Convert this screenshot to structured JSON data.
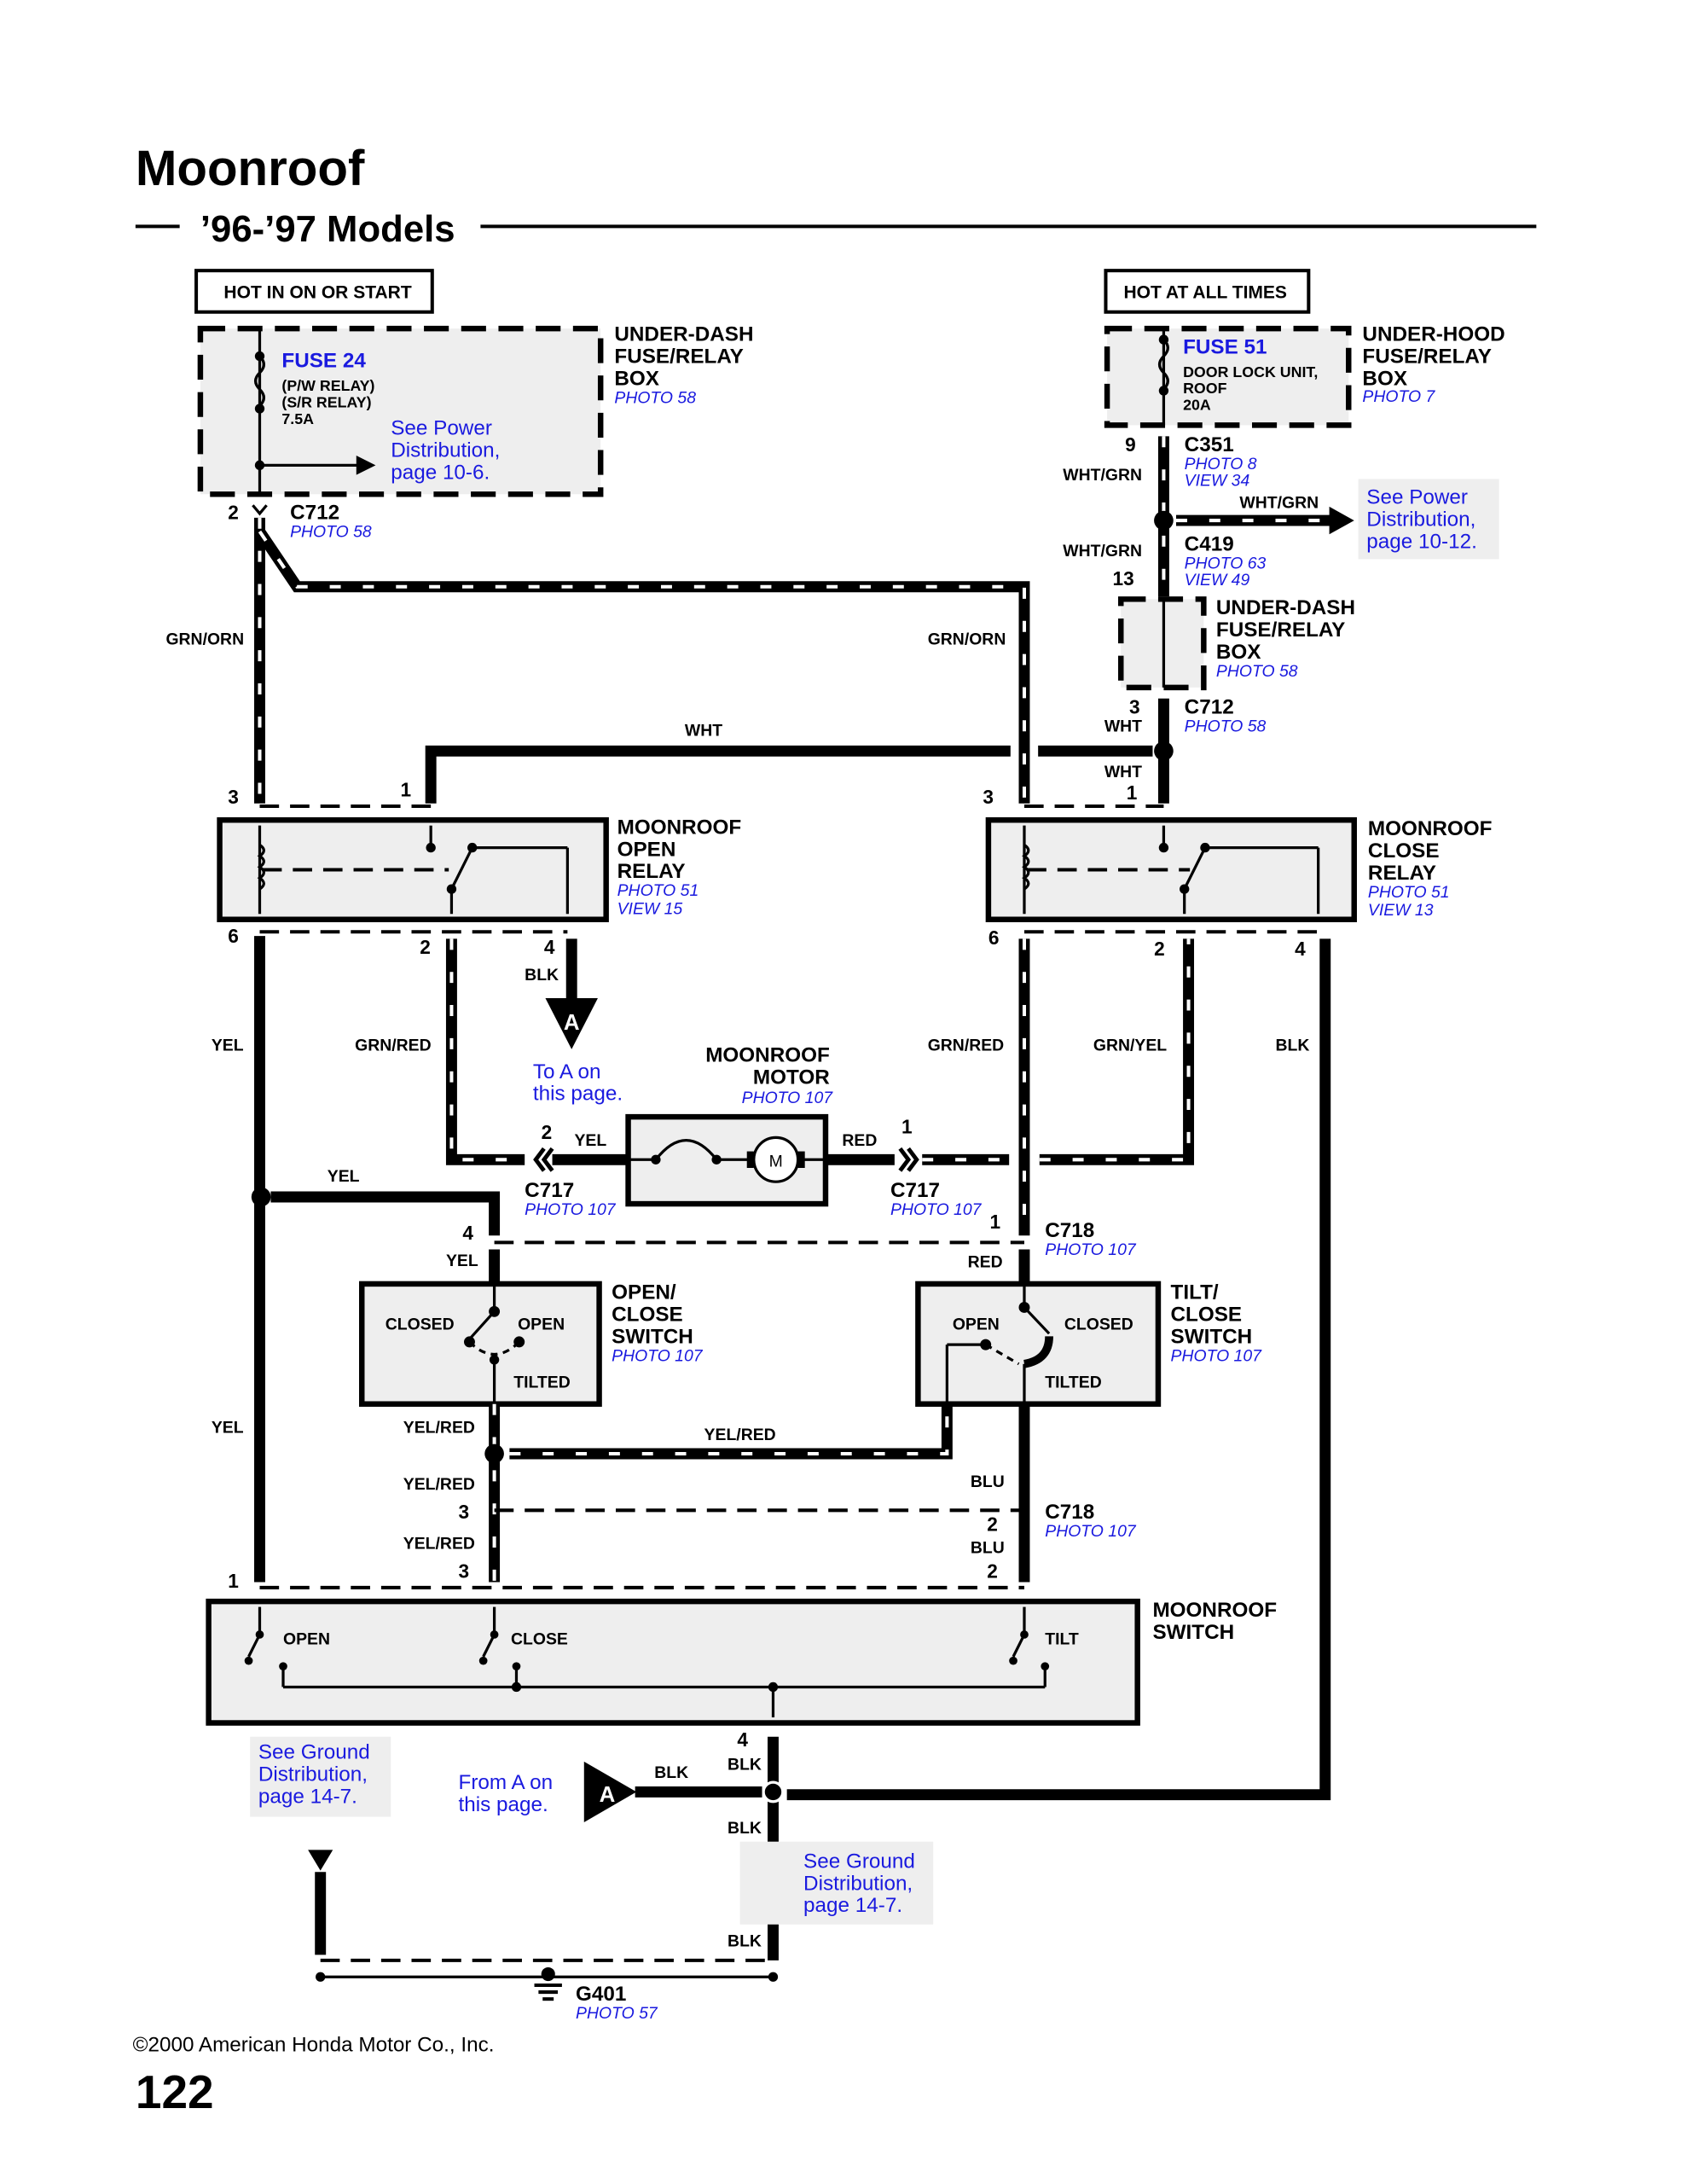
{
  "page": {
    "title": "Moonroof",
    "subtitle": "’96-’97 Models",
    "copyright": "©2000 American Honda Motor Co., Inc.",
    "page_number": "122"
  },
  "power_sources": {
    "left": "HOT IN ON OR START",
    "right": "HOT AT ALL TIMES"
  },
  "fuse_boxes": {
    "underdash_main": {
      "name_lines": [
        "UNDER-DASH",
        "FUSE/RELAY",
        "BOX"
      ],
      "photo": "PHOTO 58",
      "fuse": "FUSE 24",
      "fuse_desc": [
        "(P/W RELAY)",
        "(S/R RELAY)",
        "7.5A"
      ],
      "ref": [
        "See Power",
        "Distribution,",
        "page 10-6."
      ]
    },
    "underhood": {
      "name_lines": [
        "UNDER-HOOD",
        "FUSE/RELAY",
        "BOX"
      ],
      "photo": "PHOTO 7",
      "fuse": "FUSE 51",
      "fuse_desc": [
        "DOOR LOCK UNIT,",
        "ROOF",
        "20A"
      ],
      "ref": [
        "See Power",
        "Distribution,",
        "page 10-12."
      ]
    },
    "underdash_small": {
      "name_lines": [
        "UNDER-DASH",
        "FUSE/RELAY",
        "BOX"
      ],
      "photo": "PHOTO 58"
    }
  },
  "connectors": {
    "c712_left": {
      "name": "C712",
      "photo": "PHOTO 58",
      "pin": "2"
    },
    "c351": {
      "name": "C351",
      "photo": "PHOTO 8",
      "view": "VIEW 34",
      "pin": "9"
    },
    "c419": {
      "name": "C419",
      "photo": "PHOTO 63",
      "view": "VIEW 49",
      "pin": "13"
    },
    "c712_right": {
      "name": "C712",
      "photo": "PHOTO 58",
      "pin": "3"
    },
    "c717_left": {
      "name": "C717",
      "photo": "PHOTO 107",
      "pin": "2"
    },
    "c717_right": {
      "name": "C717",
      "photo": "PHOTO 107",
      "pin": "1"
    },
    "c718_top": {
      "name": "C718",
      "photo": "PHOTO 107",
      "pin": "1"
    },
    "c718_bottom": {
      "name": "C718",
      "photo": "PHOTO 107",
      "pin": "2"
    },
    "g401": {
      "name": "G401",
      "photo": "PHOTO 57"
    }
  },
  "components": {
    "open_relay": {
      "name_lines": [
        "MOONROOF",
        "OPEN",
        "RELAY"
      ],
      "photo": "PHOTO 51",
      "view": "VIEW 15",
      "pins": {
        "top_left": "3",
        "top_right": "1",
        "bot_left": "6",
        "bot_mid": "2",
        "bot_right": "4"
      }
    },
    "close_relay": {
      "name_lines": [
        "MOONROOF",
        "CLOSE",
        "RELAY"
      ],
      "photo": "PHOTO 51",
      "view": "VIEW 13",
      "pins": {
        "top_left": "3",
        "top_right": "1",
        "bot_left": "6",
        "bot_mid": "2",
        "bot_right": "4"
      }
    },
    "motor": {
      "name_lines": [
        "MOONROOF",
        "MOTOR"
      ],
      "photo": "PHOTO 107",
      "symbol": "M"
    },
    "open_close_switch": {
      "name_lines": [
        "OPEN/",
        "CLOSE",
        "SWITCH"
      ],
      "photo": "PHOTO 107",
      "positions": [
        "CLOSED",
        "OPEN",
        "TILTED"
      ],
      "pin_top": "4"
    },
    "tilt_close_switch": {
      "name_lines": [
        "TILT/",
        "CLOSE",
        "SWITCH"
      ],
      "photo": "PHOTO 107",
      "positions": [
        "OPEN",
        "CLOSED",
        "TILTED"
      ]
    },
    "moonroof_switch": {
      "name_lines": [
        "MOONROOF",
        "SWITCH"
      ],
      "positions": [
        "OPEN",
        "CLOSE",
        "TILT"
      ],
      "pins": {
        "p1": "1",
        "p3": "3",
        "p2": "2",
        "p4": "4"
      }
    }
  },
  "wire_colors": {
    "grn_orn": "GRN/ORN",
    "wht": "WHT",
    "wht_grn": "WHT/GRN",
    "yel": "YEL",
    "grn_red": "GRN/RED",
    "grn_yel": "GRN/YEL",
    "blk": "BLK",
    "red": "RED",
    "yel_red": "YEL/RED",
    "blu": "BLU"
  },
  "references": {
    "to_a": [
      "To A on",
      "this page."
    ],
    "from_a": [
      "From A on",
      "this page."
    ],
    "ground_left": [
      "See Ground",
      "Distribution,",
      "page 14-7."
    ],
    "ground_right": [
      "See Ground",
      "Distribution,",
      "page 14-7."
    ],
    "junction_label": "A"
  },
  "colors": {
    "reference_blue": "#1a1adf",
    "component_fill": "#eeeeee",
    "wire": "#000000"
  }
}
